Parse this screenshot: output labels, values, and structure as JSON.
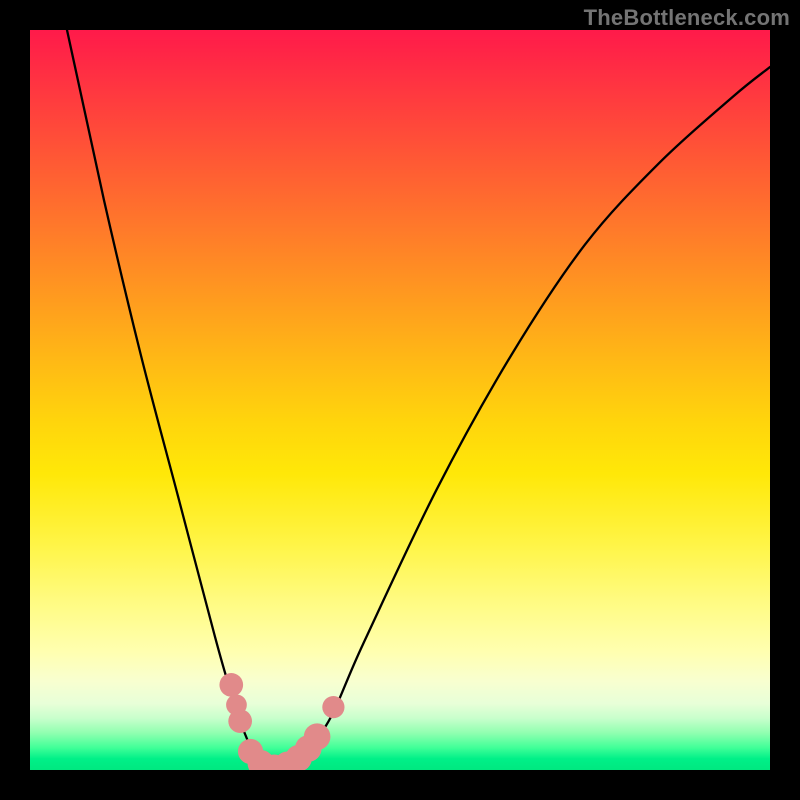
{
  "watermark": "TheBottleneck.com",
  "chart_data": {
    "type": "line",
    "title": "",
    "xlabel": "",
    "ylabel": "",
    "xlim": [
      0,
      100
    ],
    "ylim": [
      0,
      100
    ],
    "gradient_stops": [
      {
        "pct": 0,
        "color": "#ff1a4a"
      },
      {
        "pct": 18,
        "color": "#ff5a34"
      },
      {
        "pct": 36,
        "color": "#ff9a1f"
      },
      {
        "pct": 53,
        "color": "#ffd50c"
      },
      {
        "pct": 70,
        "color": "#fff54a"
      },
      {
        "pct": 84,
        "color": "#ffffb0"
      },
      {
        "pct": 93,
        "color": "#c8ffcc"
      },
      {
        "pct": 100,
        "color": "#00e880"
      }
    ],
    "series": [
      {
        "name": "bottleneck-curve",
        "x": [
          0,
          5,
          10,
          15,
          20,
          25,
          27,
          29,
          31,
          33,
          35,
          40,
          45,
          55,
          65,
          75,
          85,
          95,
          100
        ],
        "y": [
          125,
          100,
          77,
          56,
          37,
          18,
          11,
          5,
          1,
          0,
          1,
          6,
          17,
          38,
          56,
          71,
          82,
          91,
          95
        ]
      }
    ],
    "markers": {
      "name": "highlighted-points",
      "color": "#e18a8a",
      "points": [
        {
          "x": 27.2,
          "y": 11.5,
          "r": 1.6
        },
        {
          "x": 27.9,
          "y": 8.8,
          "r": 1.4
        },
        {
          "x": 28.4,
          "y": 6.6,
          "r": 1.6
        },
        {
          "x": 29.8,
          "y": 2.5,
          "r": 1.7
        },
        {
          "x": 31.2,
          "y": 0.9,
          "r": 1.8
        },
        {
          "x": 33.0,
          "y": 0.3,
          "r": 1.8
        },
        {
          "x": 34.8,
          "y": 0.7,
          "r": 1.8
        },
        {
          "x": 36.3,
          "y": 1.6,
          "r": 1.8
        },
        {
          "x": 37.6,
          "y": 2.9,
          "r": 1.8
        },
        {
          "x": 38.8,
          "y": 4.5,
          "r": 1.8
        },
        {
          "x": 41.0,
          "y": 8.5,
          "r": 1.5
        }
      ]
    }
  }
}
